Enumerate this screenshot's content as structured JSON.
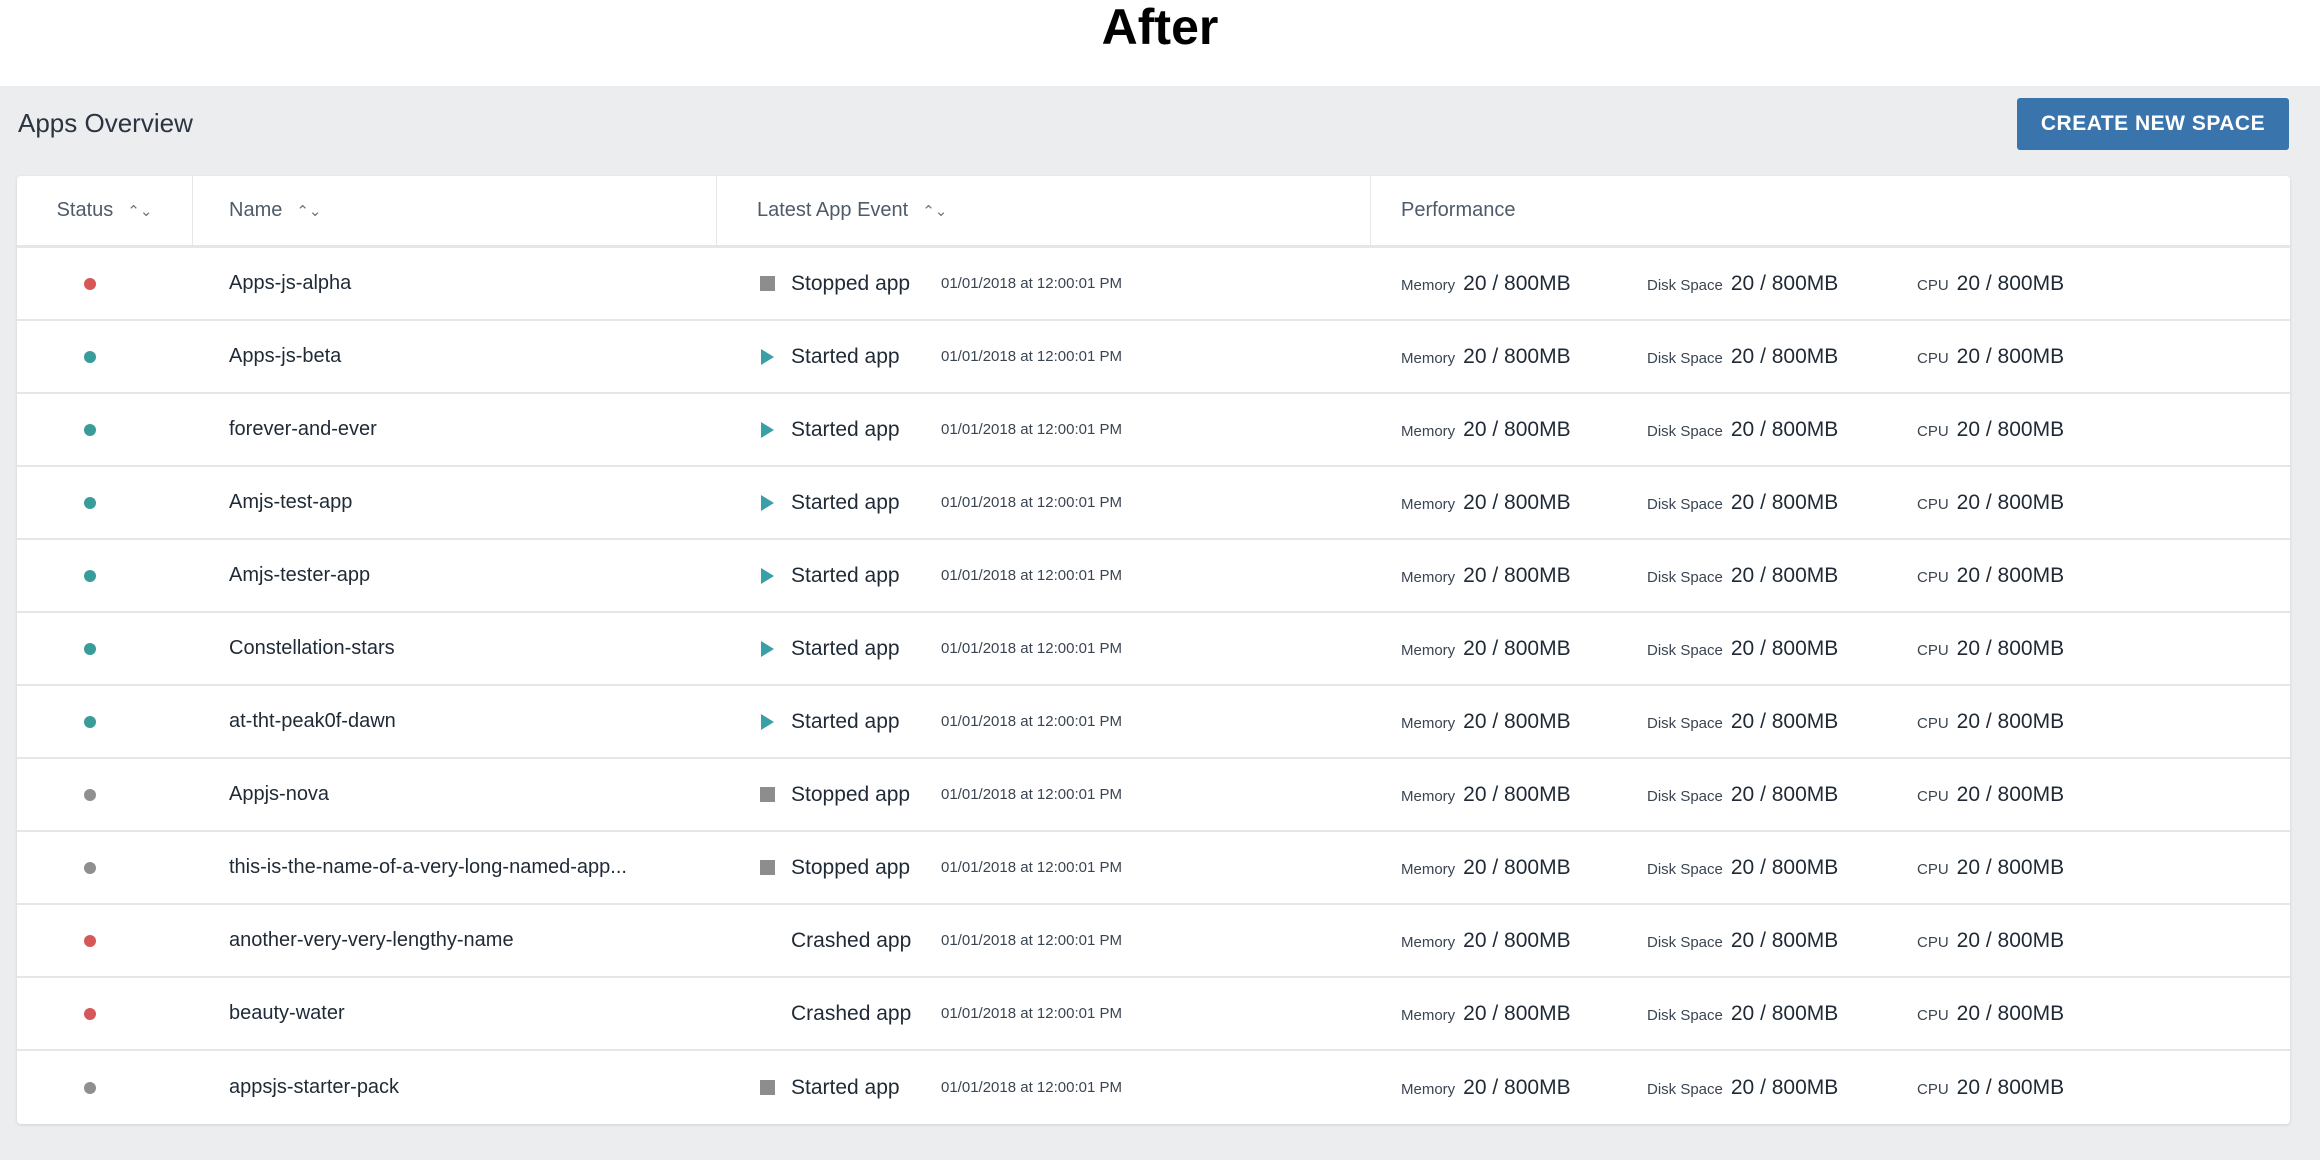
{
  "heading": "After",
  "panel": {
    "title": "Apps Overview",
    "create_button": "CREATE NEW SPACE"
  },
  "columns": {
    "status": "Status",
    "name": "Name",
    "latest_event": "Latest App Event",
    "performance": "Performance"
  },
  "perf_labels": {
    "memory": "Memory",
    "disk": "Disk Space",
    "cpu": "CPU"
  },
  "status_colors": {
    "red": "#d65757",
    "teal": "#3a9c98",
    "gray": "#8f8f8f"
  },
  "rows": [
    {
      "status": "red",
      "name": "Apps-js-alpha",
      "event_icon": "stop-icon",
      "event": "Stopped app",
      "time": "01/01/2018 at 12:00:01 PM",
      "memory": "20 / 800MB",
      "disk": "20 / 800MB",
      "cpu": "20 / 800MB"
    },
    {
      "status": "teal",
      "name": "Apps-js-beta",
      "event_icon": "play-icon",
      "event": "Started app",
      "time": "01/01/2018 at 12:00:01 PM",
      "memory": "20 / 800MB",
      "disk": "20 / 800MB",
      "cpu": "20 / 800MB"
    },
    {
      "status": "teal",
      "name": "forever-and-ever",
      "event_icon": "play-icon",
      "event": "Started app",
      "time": "01/01/2018 at 12:00:01 PM",
      "memory": "20 / 800MB",
      "disk": "20 / 800MB",
      "cpu": "20 / 800MB"
    },
    {
      "status": "teal",
      "name": "Amjs-test-app",
      "event_icon": "play-icon",
      "event": "Started app",
      "time": "01/01/2018 at 12:00:01 PM",
      "memory": "20 / 800MB",
      "disk": "20 / 800MB",
      "cpu": "20 / 800MB"
    },
    {
      "status": "teal",
      "name": "Amjs-tester-app",
      "event_icon": "play-icon",
      "event": "Started app",
      "time": "01/01/2018 at 12:00:01 PM",
      "memory": "20 / 800MB",
      "disk": "20 / 800MB",
      "cpu": "20 / 800MB"
    },
    {
      "status": "teal",
      "name": "Constellation-stars",
      "event_icon": "play-icon",
      "event": "Started app",
      "time": "01/01/2018 at 12:00:01 PM",
      "memory": "20 / 800MB",
      "disk": "20 / 800MB",
      "cpu": "20 / 800MB"
    },
    {
      "status": "teal",
      "name": "at-tht-peak0f-dawn",
      "event_icon": "play-icon",
      "event": "Started app",
      "time": "01/01/2018 at 12:00:01 PM",
      "memory": "20 / 800MB",
      "disk": "20 / 800MB",
      "cpu": "20 / 800MB"
    },
    {
      "status": "gray",
      "name": "Appjs-nova",
      "event_icon": "stop-icon",
      "event": "Stopped app",
      "time": "01/01/2018 at 12:00:01 PM",
      "memory": "20 / 800MB",
      "disk": "20 / 800MB",
      "cpu": "20 / 800MB"
    },
    {
      "status": "gray",
      "name": "this-is-the-name-of-a-very-long-named-app...",
      "event_icon": "stop-icon",
      "event": "Stopped app",
      "time": "01/01/2018 at 12:00:01 PM",
      "memory": "20 / 800MB",
      "disk": "20 / 800MB",
      "cpu": "20 / 800MB"
    },
    {
      "status": "red",
      "name": "another-very-very-lengthy-name",
      "event_icon": "none",
      "event": "Crashed app",
      "time": "01/01/2018 at 12:00:01 PM",
      "memory": "20 / 800MB",
      "disk": "20 / 800MB",
      "cpu": "20 / 800MB"
    },
    {
      "status": "red",
      "name": "beauty-water",
      "event_icon": "none",
      "event": "Crashed app",
      "time": "01/01/2018 at 12:00:01 PM",
      "memory": "20 / 800MB",
      "disk": "20 / 800MB",
      "cpu": "20 / 800MB"
    },
    {
      "status": "gray",
      "name": "appsjs-starter-pack",
      "event_icon": "stop-icon",
      "event": "Started app",
      "time": "01/01/2018 at 12:00:01 PM",
      "memory": "20 / 800MB",
      "disk": "20 / 800MB",
      "cpu": "20 / 800MB"
    }
  ]
}
